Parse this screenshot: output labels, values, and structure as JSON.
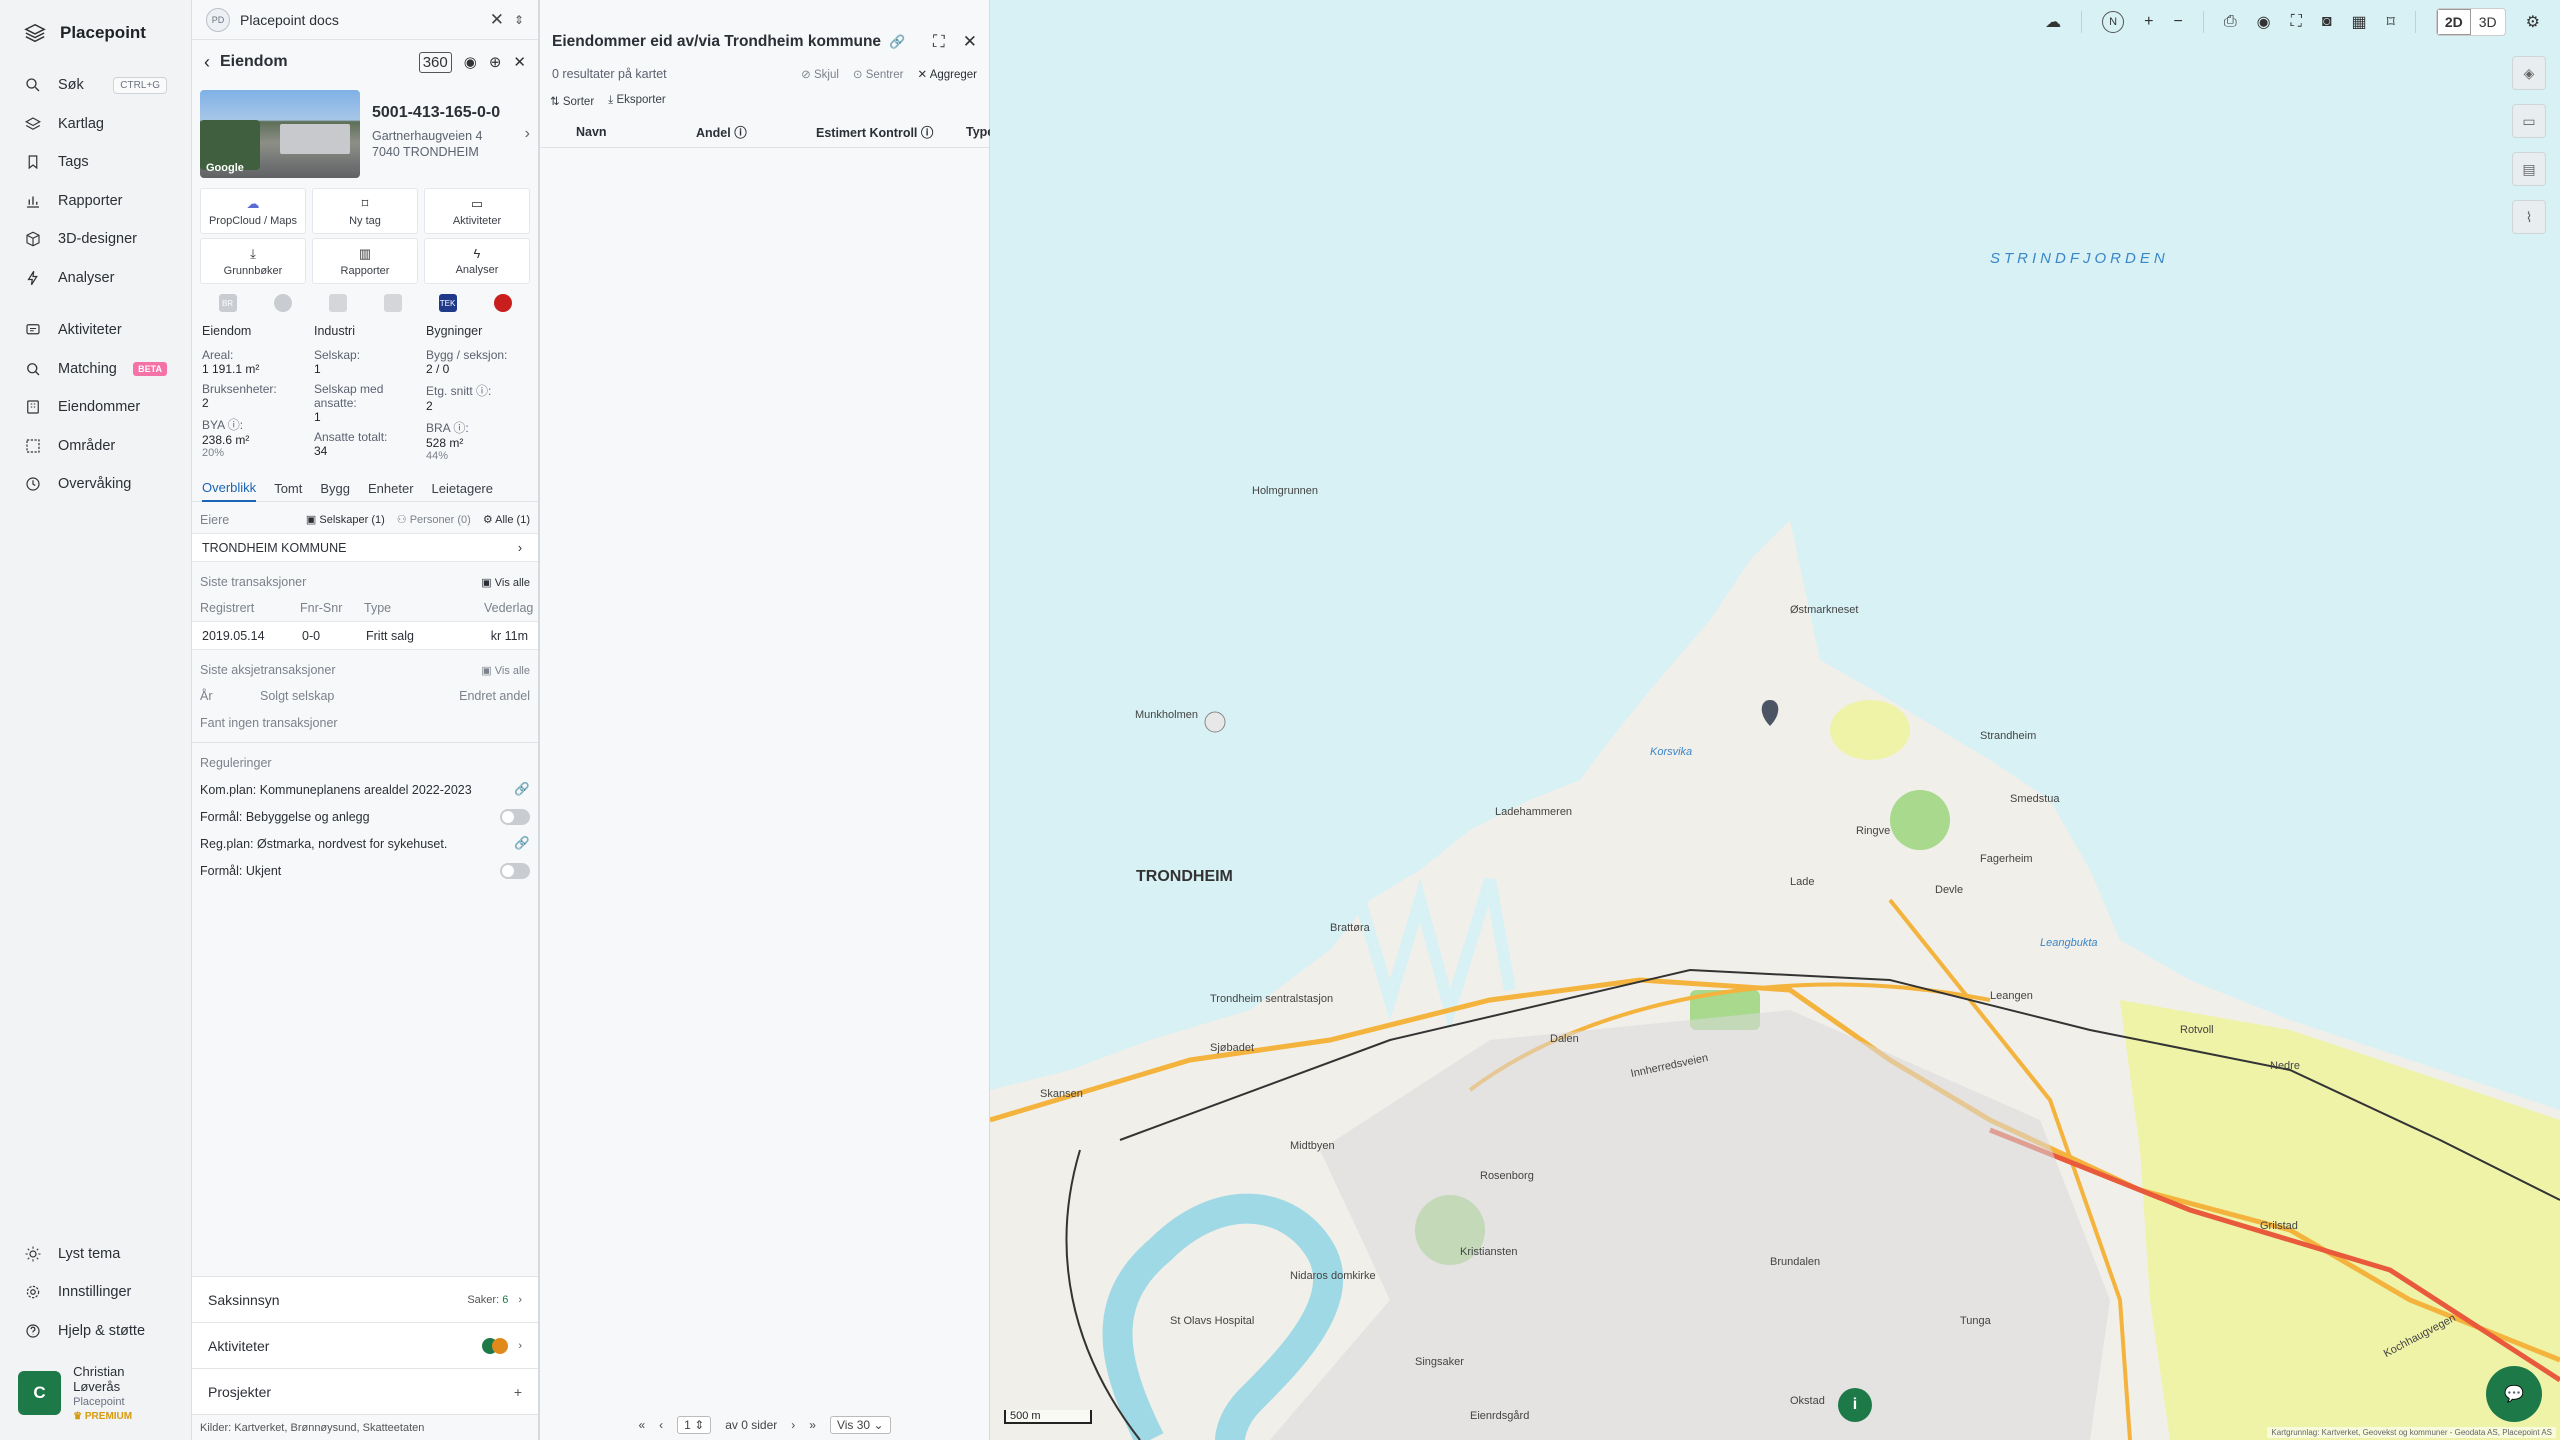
{
  "nav": {
    "brand": "Placepoint",
    "items": [
      {
        "label": "Søk",
        "icon": "search-icon",
        "kbd": "CTRL+G"
      },
      {
        "label": "Kartlag",
        "icon": "layers-icon"
      },
      {
        "label": "Tags",
        "icon": "bookmark-icon"
      },
      {
        "label": "Rapporter",
        "icon": "chart-icon"
      },
      {
        "label": "3D-designer",
        "icon": "cube-icon"
      },
      {
        "label": "Analyser",
        "icon": "bolt-icon"
      }
    ],
    "items2": [
      {
        "label": "Aktiviteter",
        "icon": "activity-icon"
      },
      {
        "label": "Matching",
        "icon": "matching-icon",
        "badge": "BETA"
      },
      {
        "label": "Eiendommer",
        "icon": "building-icon"
      },
      {
        "label": "Områder",
        "icon": "area-icon"
      },
      {
        "label": "Overvåking",
        "icon": "monitor-icon"
      }
    ],
    "bottom": [
      {
        "label": "Lyst tema",
        "icon": "sun-icon"
      },
      {
        "label": "Innstillinger",
        "icon": "gear-icon"
      },
      {
        "label": "Hjelp & støtte",
        "icon": "help-icon"
      }
    ],
    "user": {
      "initial": "C",
      "name": "Christian Løverås",
      "org": "Placepoint",
      "plan": "PREMIUM"
    }
  },
  "docs": {
    "badge": "PD",
    "title": "Placepoint docs"
  },
  "property": {
    "header": "Eiendom",
    "tag360": "360",
    "id": "5001-413-165-0-0",
    "address1": "Gartnerhaugveien 4",
    "address2": "7040 TRONDHEIM",
    "photo_credit": "Google",
    "actions": [
      {
        "label": "PropCloud / Maps",
        "icon": "cloud-icon"
      },
      {
        "label": "Ny tag",
        "icon": "bookmark-icon"
      },
      {
        "label": "Aktiviteter",
        "icon": "activity-icon"
      },
      {
        "label": "Grunnbøker",
        "icon": "download-icon"
      },
      {
        "label": "Rapporter",
        "icon": "chart-icon"
      },
      {
        "label": "Analyser",
        "icon": "bolt-icon"
      }
    ],
    "source_icons": [
      "BR",
      "globe",
      "tree",
      "bars",
      "TEK",
      "house"
    ],
    "stats": {
      "col1": {
        "head": "Eiendom",
        "items": [
          {
            "k": "Areal:",
            "v": "1 191.1 m²"
          },
          {
            "k": "Bruksenheter:",
            "v": "2"
          },
          {
            "k": "BYA ⓘ:",
            "v": "238.6 m²",
            "s": "20%"
          }
        ]
      },
      "col2": {
        "head": "Industri",
        "items": [
          {
            "k": "Selskap:",
            "v": "1"
          },
          {
            "k": "Selskap med ansatte:",
            "v": "1"
          },
          {
            "k": "Ansatte totalt:",
            "v": "34"
          }
        ]
      },
      "col3": {
        "head": "Bygninger",
        "items": [
          {
            "k": "Bygg / seksjon:",
            "v": "2 / 0"
          },
          {
            "k": "Etg. snitt ⓘ:",
            "v": "2"
          },
          {
            "k": "BRA ⓘ:",
            "v": "528 m²",
            "s": "44%"
          }
        ]
      }
    },
    "tabs": [
      "Overblikk",
      "Tomt",
      "Bygg",
      "Enheter",
      "Leietagere"
    ],
    "owners": {
      "label": "Eiere",
      "companies": "Selskaper (1)",
      "persons": "Personer (0)",
      "all": "Alle (1)",
      "owner": "TRONDHEIM KOMMUNE"
    },
    "transactions": {
      "title": "Siste transaksjoner",
      "viewall": "Vis alle",
      "cols": [
        "Registrert",
        "Fnr-Snr",
        "Type",
        "Vederlag"
      ],
      "row": [
        "2019.05.14",
        "0-0",
        "Fritt salg",
        "kr 11m"
      ]
    },
    "share": {
      "title": "Siste aksjetransaksjoner",
      "viewall": "Vis alle",
      "cols": [
        "År",
        "Solgt selskap",
        "Endret andel"
      ],
      "empty": "Fant ingen transaksjoner"
    },
    "regulations": {
      "title": "Reguleringer",
      "r1": "Kom.plan: Kommuneplanens arealdel 2022-2023",
      "r1b": "Formål: Bebyggelse og anlegg",
      "r2": "Reg.plan: Østmarka, nordvest for sykehuset.",
      "r2b": "Formål: Ukjent"
    },
    "bottom": {
      "saks": "Saksinnsyn",
      "saker_label": "Saker:",
      "saker_count": "6",
      "akt": "Aktiviteter",
      "prosj": "Prosjekter"
    },
    "sources": "Kilder: Kartverket, Brønnøysund, Skatteetaten"
  },
  "results": {
    "title": "Eiendommer eid av/via Trondheim kommune",
    "count_text": "0 resultater på kartet",
    "hide": "Skjul",
    "center": "Sentrer",
    "aggregate": "Aggreger",
    "sort": "Sorter",
    "export": "Eksporter",
    "cols": [
      "Navn",
      "Andel ⓘ",
      "Estimert Kontroll ⓘ",
      "Type"
    ],
    "pager": {
      "page": "1",
      "of": "av 0 sider",
      "per": "Vis 30"
    }
  },
  "map": {
    "labels": {
      "fjord": "STRINDFJORDEN",
      "city": "TRONDHEIM",
      "holmgrunnen": "Holmgrunnen",
      "munkholmen": "Munkholmen",
      "ostmarkneset": "Østmarkneset",
      "korsvika": "Korsvika",
      "strandheim": "Strandheim",
      "smedstua": "Smedstua",
      "ladehammeren": "Ladehammeren",
      "ringve": "Ringve",
      "lade": "Lade",
      "devle": "Devle",
      "fagerheim": "Fagerheim",
      "leangbukta": "Leangbukta",
      "leangen": "Leangen",
      "brattora": "Brattøra",
      "sentralstasjon": "Trondheim sentralstasjon",
      "sjobadet": "Sjøbadet",
      "skansen": "Skansen",
      "innherredsveien": "Innherredsveien",
      "rotvoll": "Rotvoll",
      "nedre": "Nedre",
      "midtbyen": "Midtbyen",
      "nidaros": "Nidaros domkirke",
      "kristiansten": "Kristiansten",
      "rosenborg": "Rosenborg",
      "hospital": "St Olavs Hospital",
      "singsaker": "Singsaker",
      "kochhaugvegen": "Kochhaugvegen",
      "brundalen": "Brundalen",
      "tunga": "Tunga",
      "okstad": "Okstad",
      "dalen": "Dalen",
      "grilstad": "Grilstad",
      "eienrdsgard": "Eienrdsgård"
    },
    "scale": "500 m",
    "view2d": "2D",
    "view3d": "3D",
    "north": "N",
    "attribution": "Kartgrunnlag: Kartverket, Geovekst og kommuner - Geodata AS, Placepoint AS"
  }
}
